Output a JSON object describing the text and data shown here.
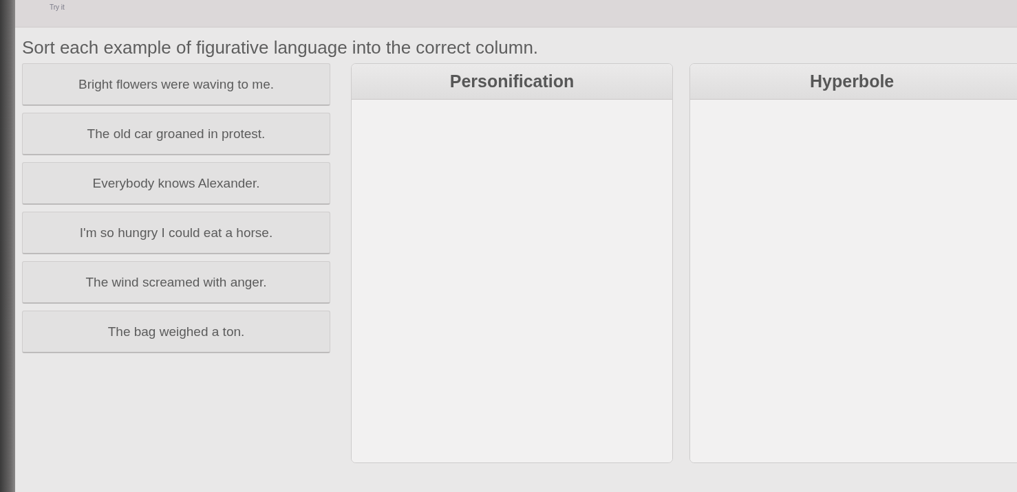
{
  "header": {
    "label": "Try it"
  },
  "instruction": "Sort each example of figurative language into the correct column.",
  "items": [
    "Bright flowers were waving to me.",
    "The old car groaned in protest.",
    "Everybody knows Alexander.",
    "I'm so hungry I could eat a horse.",
    "The wind screamed with anger.",
    "The bag weighed a ton."
  ],
  "columns": [
    {
      "title": "Personification"
    },
    {
      "title": "Hyperbole"
    }
  ]
}
